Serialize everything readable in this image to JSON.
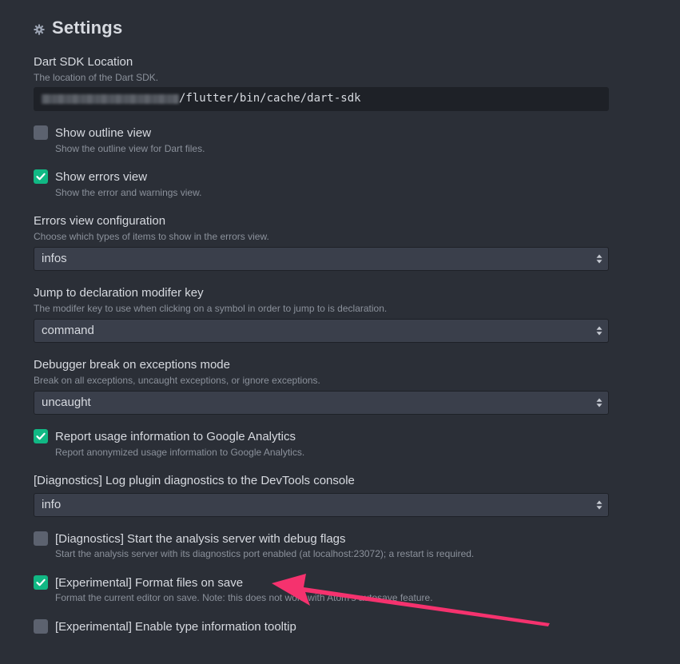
{
  "header": {
    "title": "Settings",
    "icon": "gear-icon"
  },
  "sdk": {
    "title": "Dart SDK Location",
    "desc": "The location of the Dart SDK.",
    "value": "/flutter/bin/cache/dart-sdk"
  },
  "outline": {
    "title": "Show outline view",
    "desc": "Show the outline view for Dart files.",
    "checked": false
  },
  "errors_view": {
    "title": "Show errors view",
    "desc": "Show the error and warnings view.",
    "checked": true
  },
  "errors_config": {
    "title": "Errors view configuration",
    "desc": "Choose which types of items to show in the errors view.",
    "value": "infos"
  },
  "jump_key": {
    "title": "Jump to declaration modifer key",
    "desc": "The modifer key to use when clicking on a symbol in order to jump to is declaration.",
    "value": "command"
  },
  "debugger": {
    "title": "Debugger break on exceptions mode",
    "desc": "Break on all exceptions, uncaught exceptions, or ignore exceptions.",
    "value": "uncaught"
  },
  "analytics": {
    "title": "Report usage information to Google Analytics",
    "desc": "Report anonymized usage information to Google Analytics.",
    "checked": true
  },
  "diag_log": {
    "title": "[Diagnostics] Log plugin diagnostics to the DevTools console",
    "value": "info"
  },
  "diag_debug": {
    "title": "[Diagnostics] Start the analysis server with debug flags",
    "desc": "Start the analysis server with its diagnostics port enabled (at localhost:23072); a restart is required.",
    "checked": false
  },
  "format_save": {
    "title": "[Experimental] Format files on save",
    "desc": "Format the current editor on save. Note: this does not work with Atom's autosave feature.",
    "checked": true
  },
  "type_tooltip": {
    "title": "[Experimental] Enable type information tooltip",
    "checked": false
  },
  "colors": {
    "background": "#2b2f37",
    "checkbox_on": "#11b884",
    "checkbox_off": "#5c626f",
    "annotation_arrow": "#f5326e"
  }
}
